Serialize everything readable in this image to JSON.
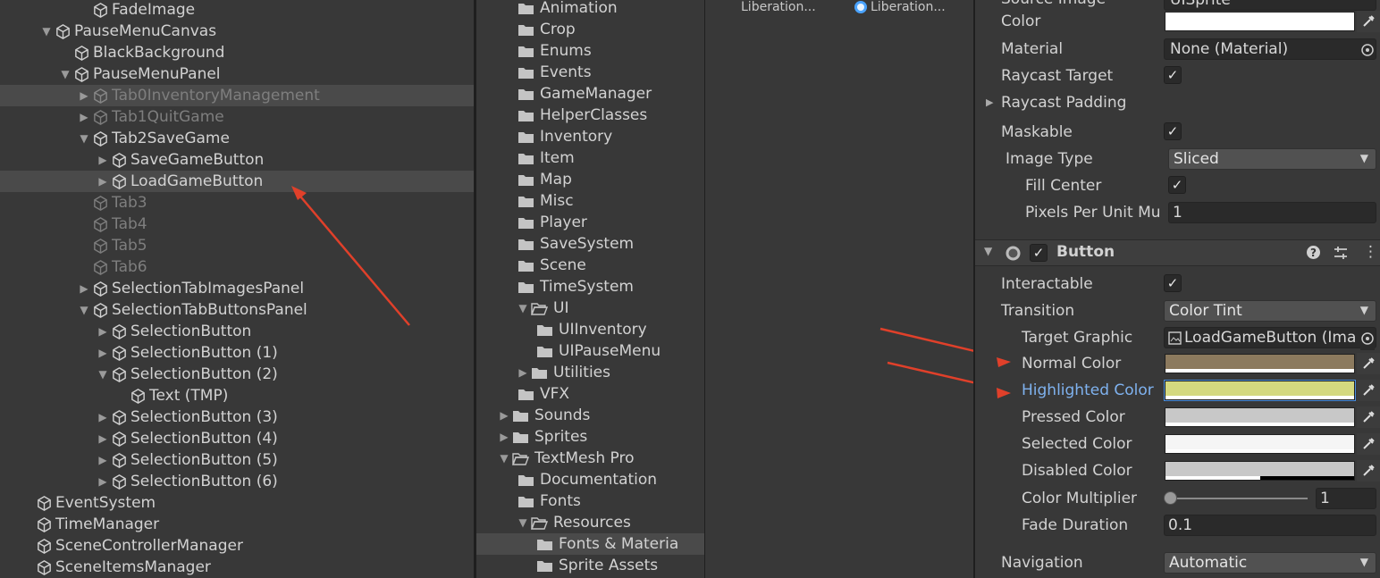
{
  "hierarchy": {
    "items": [
      {
        "label": "FadeImage",
        "indent": 5,
        "arrow": "",
        "state": ""
      },
      {
        "label": "PauseMenuCanvas",
        "indent": 3,
        "arrow": "▼",
        "state": ""
      },
      {
        "label": "BlackBackground",
        "indent": 4,
        "arrow": "",
        "state": ""
      },
      {
        "label": "PauseMenuPanel",
        "indent": 4,
        "arrow": "▼",
        "state": ""
      },
      {
        "label": "Tab0InventoryManagement",
        "indent": 5,
        "arrow": "▶",
        "state": "dim-sel"
      },
      {
        "label": "Tab1QuitGame",
        "indent": 5,
        "arrow": "▶",
        "state": "dim"
      },
      {
        "label": "Tab2SaveGame",
        "indent": 5,
        "arrow": "▼",
        "state": ""
      },
      {
        "label": "SaveGameButton",
        "indent": 6,
        "arrow": "▶",
        "state": ""
      },
      {
        "label": "LoadGameButton",
        "indent": 6,
        "arrow": "▶",
        "state": "sel"
      },
      {
        "label": "Tab3",
        "indent": 5,
        "arrow": "",
        "state": "dim"
      },
      {
        "label": "Tab4",
        "indent": 5,
        "arrow": "",
        "state": "dim"
      },
      {
        "label": "Tab5",
        "indent": 5,
        "arrow": "",
        "state": "dim"
      },
      {
        "label": "Tab6",
        "indent": 5,
        "arrow": "",
        "state": "dim"
      },
      {
        "label": "SelectionTabImagesPanel",
        "indent": 5,
        "arrow": "▶",
        "state": ""
      },
      {
        "label": "SelectionTabButtonsPanel",
        "indent": 5,
        "arrow": "▼",
        "state": ""
      },
      {
        "label": "SelectionButton",
        "indent": 6,
        "arrow": "▶",
        "state": ""
      },
      {
        "label": "SelectionButton (1)",
        "indent": 6,
        "arrow": "▶",
        "state": ""
      },
      {
        "label": "SelectionButton (2)",
        "indent": 6,
        "arrow": "▼",
        "state": ""
      },
      {
        "label": "Text (TMP)",
        "indent": 7,
        "arrow": "",
        "state": ""
      },
      {
        "label": "SelectionButton (3)",
        "indent": 6,
        "arrow": "▶",
        "state": ""
      },
      {
        "label": "SelectionButton (4)",
        "indent": 6,
        "arrow": "▶",
        "state": ""
      },
      {
        "label": "SelectionButton (5)",
        "indent": 6,
        "arrow": "▶",
        "state": ""
      },
      {
        "label": "SelectionButton (6)",
        "indent": 6,
        "arrow": "▶",
        "state": ""
      },
      {
        "label": "EventSystem",
        "indent": 2,
        "arrow": "",
        "state": ""
      },
      {
        "label": "TimeManager",
        "indent": 2,
        "arrow": "",
        "state": ""
      },
      {
        "label": "SceneControllerManager",
        "indent": 2,
        "arrow": "",
        "state": ""
      },
      {
        "label": "SceneItemsManager",
        "indent": 2,
        "arrow": "",
        "state": ""
      }
    ]
  },
  "project": {
    "folders": [
      {
        "label": "Animation",
        "indent": 2,
        "arrow": "",
        "open": false,
        "state": ""
      },
      {
        "label": "Crop",
        "indent": 2,
        "arrow": "",
        "open": false,
        "state": ""
      },
      {
        "label": "Enums",
        "indent": 2,
        "arrow": "",
        "open": false,
        "state": ""
      },
      {
        "label": "Events",
        "indent": 2,
        "arrow": "",
        "open": false,
        "state": ""
      },
      {
        "label": "GameManager",
        "indent": 2,
        "arrow": "",
        "open": false,
        "state": ""
      },
      {
        "label": "HelperClasses",
        "indent": 2,
        "arrow": "",
        "open": false,
        "state": ""
      },
      {
        "label": "Inventory",
        "indent": 2,
        "arrow": "",
        "open": false,
        "state": ""
      },
      {
        "label": "Item",
        "indent": 2,
        "arrow": "",
        "open": false,
        "state": ""
      },
      {
        "label": "Map",
        "indent": 2,
        "arrow": "",
        "open": false,
        "state": ""
      },
      {
        "label": "Misc",
        "indent": 2,
        "arrow": "",
        "open": false,
        "state": ""
      },
      {
        "label": "Player",
        "indent": 2,
        "arrow": "",
        "open": false,
        "state": ""
      },
      {
        "label": "SaveSystem",
        "indent": 2,
        "arrow": "",
        "open": false,
        "state": ""
      },
      {
        "label": "Scene",
        "indent": 2,
        "arrow": "",
        "open": false,
        "state": ""
      },
      {
        "label": "TimeSystem",
        "indent": 2,
        "arrow": "",
        "open": false,
        "state": ""
      },
      {
        "label": "UI",
        "indent": 1,
        "arrow": "▼",
        "open": true,
        "state": ""
      },
      {
        "label": "UIInventory",
        "indent": 3,
        "arrow": "",
        "open": false,
        "state": ""
      },
      {
        "label": "UIPauseMenu",
        "indent": 3,
        "arrow": "",
        "open": false,
        "state": ""
      },
      {
        "label": "Utilities",
        "indent": 1,
        "arrow": "▶",
        "open": false,
        "state": ""
      },
      {
        "label": "VFX",
        "indent": 2,
        "arrow": "",
        "open": false,
        "state": ""
      },
      {
        "label": "Sounds",
        "indent": 0,
        "arrow": "▶",
        "open": false,
        "state": ""
      },
      {
        "label": "Sprites",
        "indent": 0,
        "arrow": "▶",
        "open": false,
        "state": ""
      },
      {
        "label": "TextMesh Pro",
        "indent": 0,
        "arrow": "▼",
        "open": true,
        "state": ""
      },
      {
        "label": "Documentation",
        "indent": 2,
        "arrow": "",
        "open": false,
        "state": ""
      },
      {
        "label": "Fonts",
        "indent": 2,
        "arrow": "",
        "open": false,
        "state": ""
      },
      {
        "label": "Resources",
        "indent": 1,
        "arrow": "▼",
        "open": true,
        "state": ""
      },
      {
        "label": "Fonts & Materia",
        "indent": 3,
        "arrow": "",
        "open": false,
        "state": "sel"
      },
      {
        "label": "Sprite Assets",
        "indent": 3,
        "arrow": "",
        "open": false,
        "state": ""
      }
    ],
    "files": [
      "Liberation...",
      "Liberation..."
    ]
  },
  "inspector": {
    "source_image_label": "Source Image",
    "source_image_value": "UISprite",
    "color_label": "Color",
    "color_value": "#ffffff",
    "material_label": "Material",
    "material_value": "None (Material)",
    "raycast_target_label": "Raycast Target",
    "raycast_padding_label": "Raycast Padding",
    "maskable_label": "Maskable",
    "image_type_label": "Image Type",
    "image_type_value": "Sliced",
    "fill_center_label": "Fill Center",
    "pixels_per_unit_label": "Pixels Per Unit Mu",
    "pixels_per_unit_value": "1",
    "button_title": "Button",
    "interactable_label": "Interactable",
    "transition_label": "Transition",
    "transition_value": "Color Tint",
    "target_graphic_label": "Target Graphic",
    "target_graphic_value": "LoadGameButton (Ima",
    "normal_color_label": "Normal Color",
    "normal_color_value": "#8c7a5e",
    "highlighted_color_label": "Highlighted Color",
    "highlighted_color_value": "#d4d97f",
    "pressed_color_label": "Pressed Color",
    "pressed_color_value": "#c8c8c8",
    "selected_color_label": "Selected Color",
    "selected_color_value": "#f5f5f5",
    "disabled_color_label": "Disabled Color",
    "disabled_color_value": "#c8c8c8",
    "color_multiplier_label": "Color Multiplier",
    "color_multiplier_value": "1",
    "fade_duration_label": "Fade Duration",
    "fade_duration_value": "0.1",
    "navigation_label": "Navigation",
    "navigation_value": "Automatic"
  },
  "colors": {
    "accent_label": "#7fb2ef",
    "annotation_arrow": "#e0402a"
  }
}
